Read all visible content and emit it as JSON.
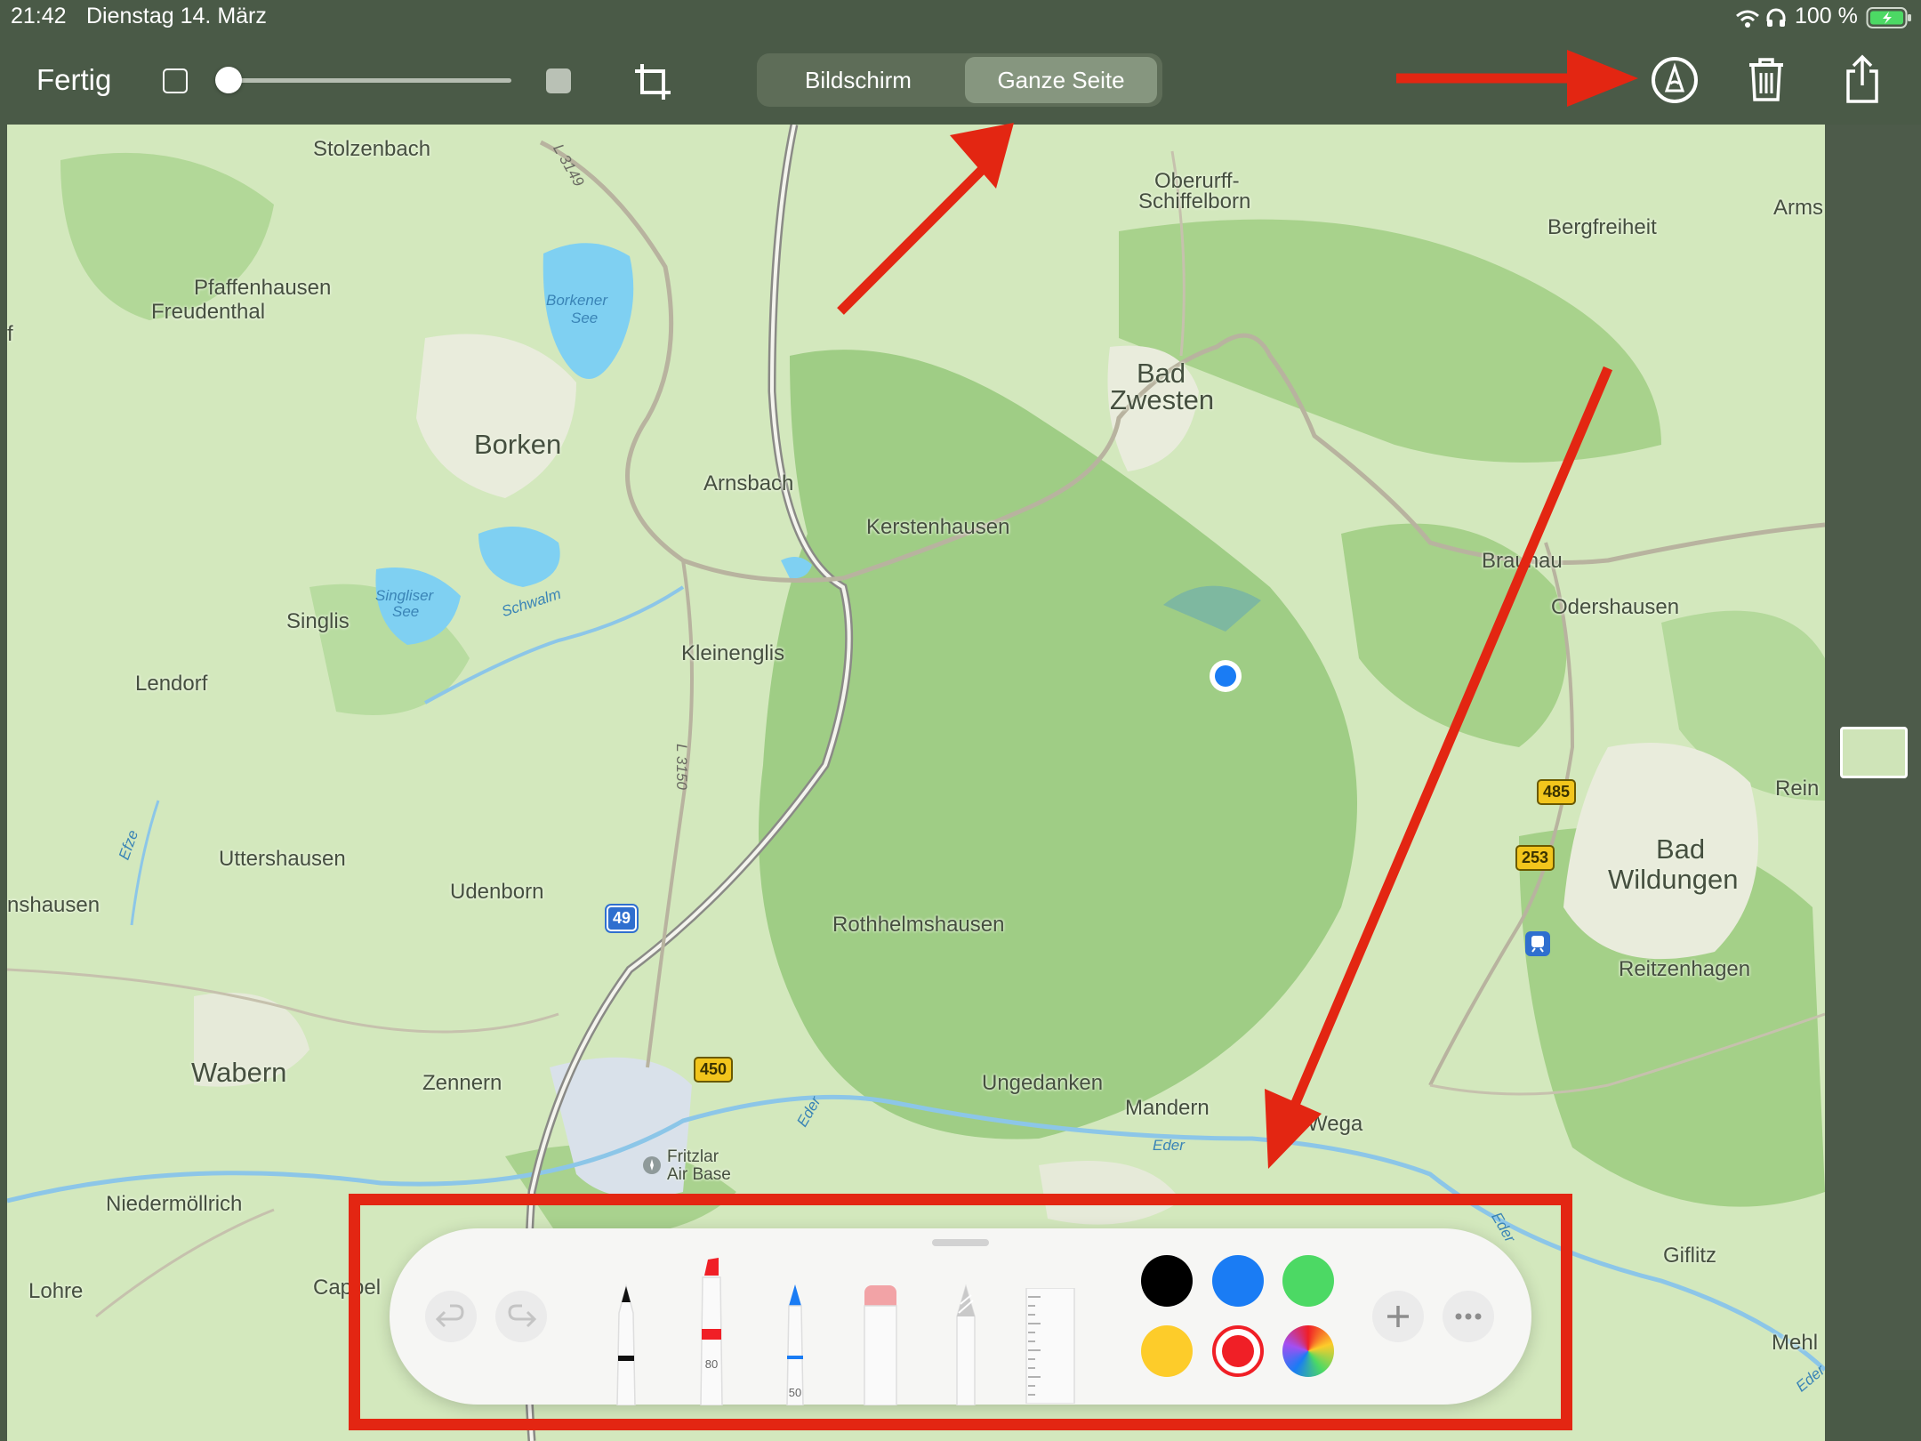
{
  "status_bar": {
    "time": "21:42",
    "date": "Dienstag 14. März",
    "battery": "100 %"
  },
  "toolbar": {
    "done_label": "Fertig",
    "segments": [
      "Bildschirm",
      "Ganze Seite"
    ],
    "selected_segment": "Ganze Seite",
    "opacity_level": 0.0
  },
  "map": {
    "places": [
      "Stolzenbach",
      "Pfaffenhausen",
      "Freudenthal",
      "Borken",
      "Arnsbach",
      "Kerstenhausen",
      "Singlis",
      "Lendorf",
      "Kleinenglis",
      "Oberurff-",
      "Schiffelborn",
      "Bergfreiheit",
      "Arms",
      "Bad",
      "Zwesten",
      "Braunau",
      "Odershausen",
      "Rein",
      "Bad",
      "Wildungen",
      "Reitzenhagen",
      "Uttershausen",
      "Udenborn",
      "Rothhelmshausen",
      "nshausen",
      "Wabern",
      "Zennern",
      "Ungedanken",
      "Mandern",
      "Wega",
      "Niedermöllrich",
      "Lohre",
      "Cappel",
      "Giflitz",
      "Mehl",
      "f"
    ],
    "water_labels": [
      "Borkener",
      "See",
      "Singliser",
      "See",
      "Schwalm",
      "Eder",
      "Eder",
      "Eder",
      "Eder",
      "Efze"
    ],
    "road_labels": [
      "L 3149",
      "L 3150"
    ],
    "route_shields": [
      "49",
      "450",
      "485",
      "253"
    ],
    "airbase": [
      "Fritzlar",
      "Air Base"
    ]
  },
  "markup_palette": {
    "tools": [
      {
        "name": "pen",
        "value": ""
      },
      {
        "name": "marker",
        "value": "80"
      },
      {
        "name": "pencil",
        "value": "50"
      },
      {
        "name": "eraser",
        "value": ""
      },
      {
        "name": "lasso",
        "value": ""
      },
      {
        "name": "ruler",
        "value": ""
      }
    ],
    "colors": [
      "#000000",
      "#1a7cf4",
      "#4cd964",
      "#fdcc2a",
      "#f01f26",
      "multicolor"
    ],
    "selected_color": "#f01f26"
  },
  "icons": [
    "crop-icon",
    "markup-icon",
    "trash-icon",
    "share-icon",
    "undo-icon",
    "redo-icon",
    "plus-icon",
    "more-icon",
    "wifi-icon",
    "headphones-icon",
    "battery-icon"
  ],
  "annotation_color": "#e32612"
}
